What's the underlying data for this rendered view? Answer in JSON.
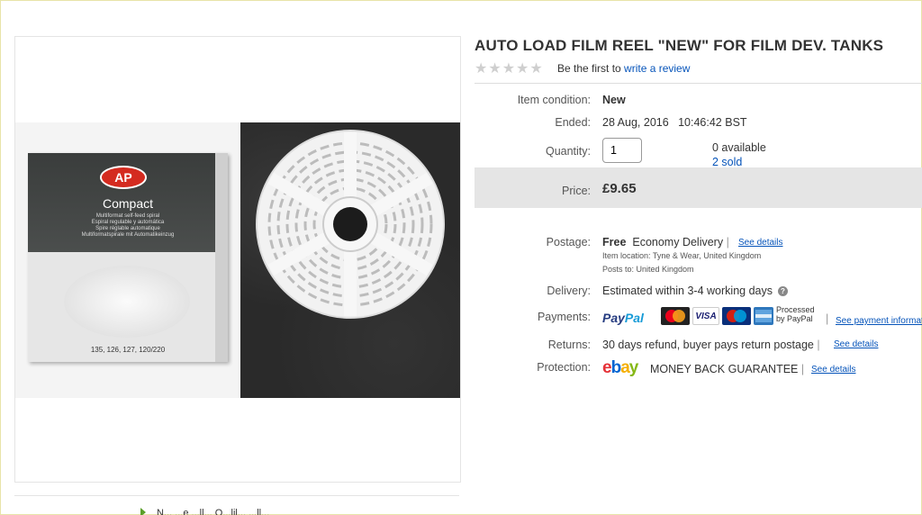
{
  "listing": {
    "title": "AUTO LOAD FILM REEL \"NEW\" FOR FILM DEV. TANKS",
    "rating_stars": 0,
    "review_prefix": "Be the first to",
    "review_link": "write a review"
  },
  "image": {
    "logo": "AP",
    "box_title": "Compact",
    "box_lines": [
      "Multiformat self-feed spiral",
      "Espiral regulable y automática",
      "Spire réglable automatique",
      "Multiformatspirale mit Automatikeinzug"
    ],
    "box_formats": "135, 126, 127, 120/220"
  },
  "details": {
    "condition_label": "Item condition:",
    "condition_value": "New",
    "ended_label": "Ended:",
    "ended_value": "28 Aug, 2016   10:46:42 BST",
    "quantity_label": "Quantity:",
    "quantity_value": "1",
    "available": "0 available",
    "sold": "2 sold",
    "price_label": "Price:",
    "price_value": "£9.65"
  },
  "shipping": {
    "postage_label": "Postage:",
    "postage_free": "Free",
    "postage_type": "Economy Delivery",
    "see_details": "See details",
    "item_location": "Item location:  Tyne & Wear, United Kingdom",
    "posts_to": "Posts to:  United Kingdom",
    "delivery_label": "Delivery:",
    "delivery_value": "Estimated within 3-4 working days",
    "help_glyph": "?",
    "payments_label": "Payments:",
    "paypal_a": "Pay",
    "paypal_b": "Pal",
    "cards": [
      "MasterCard",
      "VISA",
      "Maestro",
      "AMEX"
    ],
    "processed_line1": "Processed",
    "processed_line2": "by PayPal",
    "see_payment": "See payment information",
    "returns_label": "Returns:",
    "returns_value": "30 days refund, buyer pays return postage",
    "protection_label": "Protection:",
    "ebay_letters": [
      "e",
      "b",
      "a",
      "y"
    ],
    "guarantee": "MONEY BACK GUARANTEE"
  },
  "footer": {
    "text": "N...                    ...e    ...ll...   O...lil...       ...ll..."
  },
  "colors": {
    "link": "#0654ba",
    "price_band": "#e5e5e5",
    "ebay_e": "#e53238",
    "ebay_b": "#0064d2",
    "ebay_a": "#f5af02",
    "ebay_y": "#86b817"
  }
}
